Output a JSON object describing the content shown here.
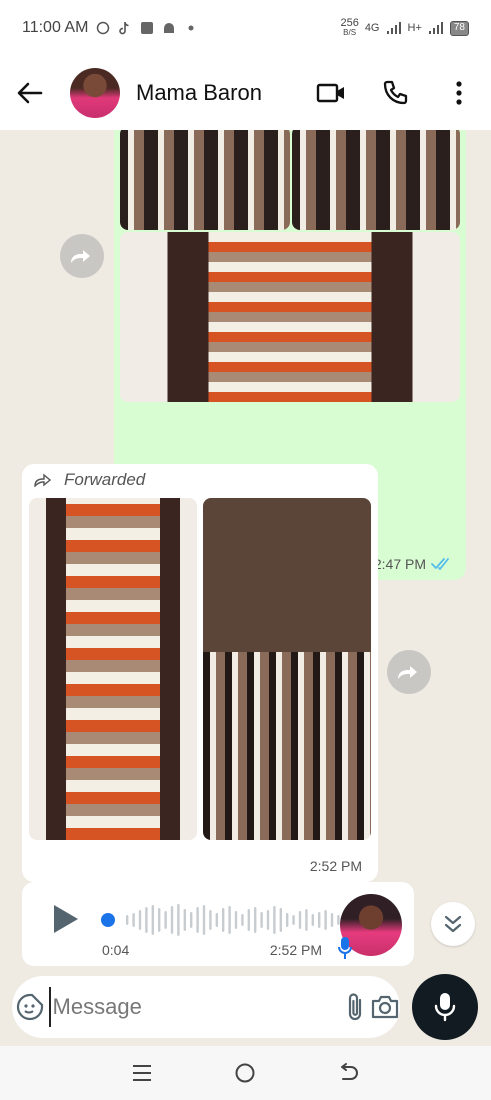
{
  "status_bar": {
    "time": "11:00 AM",
    "net_speed_value": "256",
    "net_speed_unit": "B/S",
    "network_1": "4G",
    "network_2": "H+",
    "battery": "78",
    "icons": [
      "whatsapp-icon",
      "tiktok-icon",
      "square-icon",
      "android-icon",
      "dot-icon"
    ]
  },
  "header": {
    "contact_name": "Mama Baron",
    "icons": [
      "back-arrow-icon",
      "video-call-icon",
      "phone-icon",
      "more-icon"
    ]
  },
  "messages": [
    {
      "direction": "outgoing",
      "type": "image-album",
      "time": "2:47 PM",
      "read": true
    },
    {
      "direction": "incoming",
      "type": "image-album",
      "forwarded_label": "Forwarded",
      "time": "2:52 PM"
    },
    {
      "direction": "incoming",
      "type": "voice-note",
      "duration": "0:04",
      "time": "2:52 PM",
      "progress": 0
    }
  ],
  "composer": {
    "placeholder": "Message"
  },
  "colors": {
    "outgoing_bubble": "#d9fdd3",
    "incoming_bubble": "#ffffff",
    "chat_background": "#efeae2",
    "read_ticks": "#53bdeb",
    "voice_dot": "#1a73e8"
  }
}
